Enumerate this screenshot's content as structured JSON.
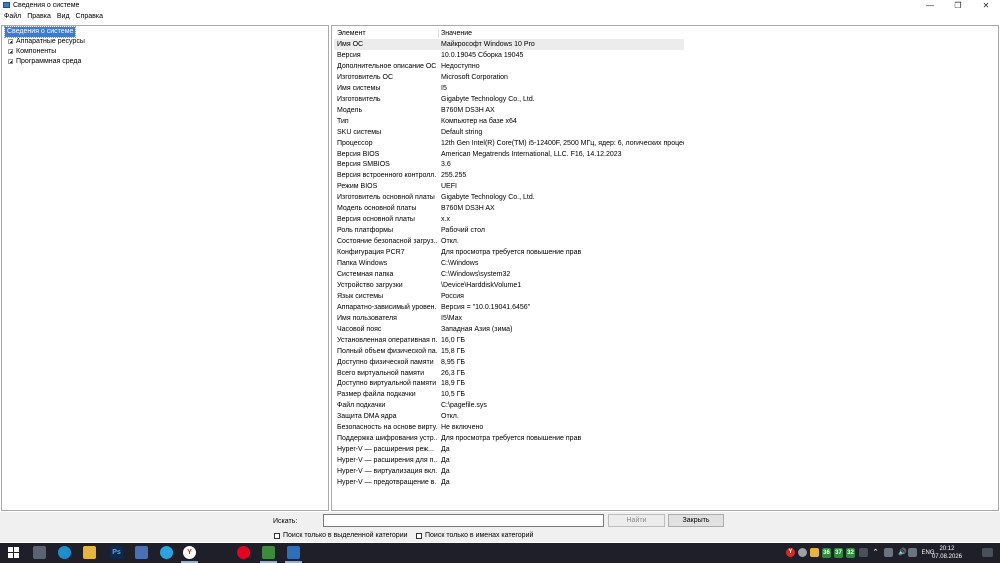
{
  "window": {
    "title": "Сведения о системе",
    "minimize": "—",
    "restore": "❐",
    "close": "✕"
  },
  "menu": [
    "Файл",
    "Правка",
    "Вид",
    "Справка"
  ],
  "tree": {
    "root": "Сведения о системе",
    "children": [
      "Аппаратные ресурсы",
      "Компоненты",
      "Программная среда"
    ]
  },
  "list": {
    "col_item": "Элемент",
    "col_value": "Значение",
    "rows": [
      [
        "Имя ОС",
        "Майкрософт Windows 10 Pro"
      ],
      [
        "Версия",
        "10.0.19045 Сборка 19045"
      ],
      [
        "Дополнительное описание ОС",
        "Недоступно"
      ],
      [
        "Изготовитель ОС",
        "Microsoft Corporation"
      ],
      [
        "Имя системы",
        "I5"
      ],
      [
        "Изготовитель",
        "Gigabyte Technology Co., Ltd."
      ],
      [
        "Модель",
        "B760M DS3H AX"
      ],
      [
        "Тип",
        "Компьютер на базе x64"
      ],
      [
        "SKU системы",
        "Default string"
      ],
      [
        "Процессор",
        "12th Gen Intel(R) Core(TM) i5-12400F, 2500 МГц, ядер: 6, логических процес..."
      ],
      [
        "Версия BIOS",
        "American Megatrends International, LLC. F16, 14.12.2023"
      ],
      [
        "Версия SMBIOS",
        "3.6"
      ],
      [
        "Версия встроенного контролл...",
        "255.255"
      ],
      [
        "Режим BIOS",
        "UEFI"
      ],
      [
        "Изготовитель основной платы",
        "Gigabyte Technology Co., Ltd."
      ],
      [
        "Модель основной платы",
        "B760M DS3H AX"
      ],
      [
        "Версия основной платы",
        "x.x"
      ],
      [
        "Роль платформы",
        "Рабочий стол"
      ],
      [
        "Состояние безопасной загруз...",
        "Откл."
      ],
      [
        "Конфигурация PCR7",
        "Для просмотра требуется повышение прав"
      ],
      [
        "Папка Windows",
        "C:\\Windows"
      ],
      [
        "Системная папка",
        "C:\\Windows\\system32"
      ],
      [
        "Устройство загрузки",
        "\\Device\\HarddiskVolume1"
      ],
      [
        "Язык системы",
        "Россия"
      ],
      [
        "Аппаратно-зависимый уровен...",
        "Версия = \"10.0.19041.6456\""
      ],
      [
        "Имя пользователя",
        "I5\\Max"
      ],
      [
        "Часовой пояс",
        "Западная Азия (зима)"
      ],
      [
        "Установленная оперативная п...",
        "16,0 ГБ"
      ],
      [
        "Полный объем физической па...",
        "15,8 ГБ"
      ],
      [
        "Доступно физической памяти",
        "8,95 ГБ"
      ],
      [
        "Всего виртуальной памяти",
        "26,3 ГБ"
      ],
      [
        "Доступно виртуальной памяти",
        "18,9 ГБ"
      ],
      [
        "Размер файла подкачки",
        "10,5 ГБ"
      ],
      [
        "Файл подкачки",
        "C:\\pagefile.sys"
      ],
      [
        "Защита DMA ядра",
        "Откл."
      ],
      [
        "Безопасность на основе вирту...",
        "Не включено"
      ],
      [
        "Поддержка шифрования устр...",
        "Для просмотра требуется повышение прав"
      ],
      [
        "Hyper-V — расширения реж...",
        "Да"
      ],
      [
        "Hyper-V — расширения для п...",
        "Да"
      ],
      [
        "Hyper-V — виртуализация вкл...",
        "Да"
      ],
      [
        "Hyper-V — предотвращение в...",
        "Да"
      ]
    ]
  },
  "search": {
    "label": "Искать:",
    "value": "",
    "find_button": "Найти",
    "close_button": "Закрыть",
    "cb_selected_category": "Поиск только в выделенной категории",
    "cb_category_names": "Поиск только в именах категорий"
  },
  "taskbar": {
    "language": "ENG",
    "time": "20:12",
    "date": "07.08.2026",
    "tray_numbers": [
      "36",
      "37",
      "32"
    ]
  }
}
